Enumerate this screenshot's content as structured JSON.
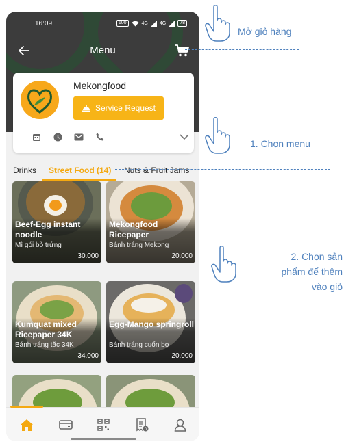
{
  "status_bar": {
    "time": "16:09",
    "net_badge": "100",
    "signal_1": "4G",
    "signal_2": "4G",
    "battery": "78"
  },
  "app_bar": {
    "title": "Menu"
  },
  "store": {
    "name": "Mekongfood",
    "service_button_label": "Service Request"
  },
  "tabs": [
    {
      "label": "Drinks",
      "active": false
    },
    {
      "label": "Street Food (14)",
      "active": true
    },
    {
      "label": "Nuts & Fruit Jams",
      "active": false
    }
  ],
  "products": [
    {
      "name": "Beef-Egg instant noodle",
      "subtitle": "Mì gói bò trứng",
      "price": "30.000"
    },
    {
      "name": "Mekongfood Ricepaper",
      "subtitle": "Bánh tráng Mekong",
      "price": "20.000"
    },
    {
      "name": "Kumquat mixed Ricepaper 34K",
      "subtitle": "Bánh tráng tắc 34K",
      "price": "34.000"
    },
    {
      "name": "Egg-Mango springroll",
      "subtitle": "Bánh tráng cuốn bơ",
      "price": "20.000"
    },
    {
      "name": "",
      "subtitle": "",
      "price": ""
    },
    {
      "name": "",
      "subtitle": "",
      "price": ""
    }
  ],
  "bottom_nav": {
    "items": [
      "home-icon",
      "wallet-icon",
      "qr-code-icon",
      "receipt-icon",
      "user-icon"
    ],
    "receipt_badge": "0"
  },
  "annotations": {
    "open_cart": "Mở giỏ hàng",
    "step1": "1. Chọn menu",
    "step2_line1": "2. Chọn sản",
    "step2_line2": "phẩm để thêm",
    "step2_line3": "vào giỏ"
  },
  "colors": {
    "accent": "#f4a911",
    "annotation": "#4f81bd",
    "brand_green": "#1f5a30"
  }
}
